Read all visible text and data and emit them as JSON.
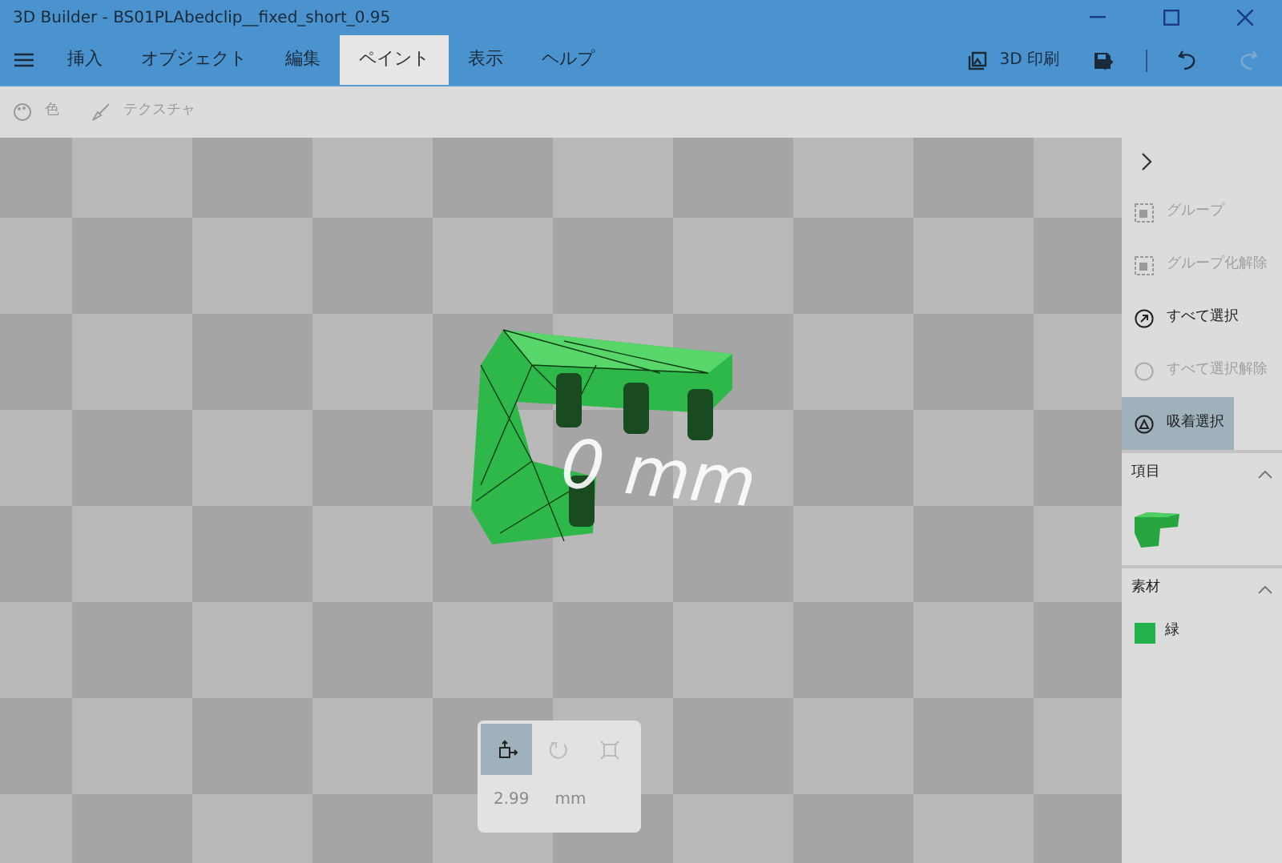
{
  "window": {
    "title": "3D Builder - BS01PLAbedclip__fixed_short_0.95"
  },
  "menu_tabs": [
    {
      "label": "挿入",
      "selected": false
    },
    {
      "label": "オブジェクト",
      "selected": false
    },
    {
      "label": "編集",
      "selected": false
    },
    {
      "label": "ペイント",
      "selected": true
    },
    {
      "label": "表示",
      "selected": false
    },
    {
      "label": "ヘルプ",
      "selected": false
    }
  ],
  "print_button": {
    "label": "3D 印刷"
  },
  "toolbar": [
    {
      "kind": "palette",
      "label": "色"
    },
    {
      "kind": "brush",
      "label": "テクスチャ"
    }
  ],
  "viewport": {
    "dimension_label": "0 mm"
  },
  "side_actions": [
    {
      "kind": "group",
      "label": "グループ",
      "disabled": true,
      "selected": false
    },
    {
      "kind": "ungroup",
      "label": "グループ化解除",
      "disabled": true,
      "selected": false
    },
    {
      "kind": "select_all",
      "label": "すべて選択",
      "disabled": false,
      "selected": false
    },
    {
      "kind": "deselect",
      "label": "すべて選択解除",
      "disabled": true,
      "selected": false
    },
    {
      "kind": "snap",
      "label": "吸着選択",
      "disabled": false,
      "selected": true
    }
  ],
  "sections": [
    {
      "kind": "items",
      "title": "項目",
      "expanded": true
    },
    {
      "kind": "materials",
      "title": "素材",
      "expanded": true,
      "materials": [
        {
          "label": "緑",
          "color": "#22b14c"
        }
      ]
    }
  ],
  "transform_tools": [
    {
      "kind": "move",
      "selected": true
    },
    {
      "kind": "rotate",
      "selected": false
    },
    {
      "kind": "scale",
      "selected": false
    }
  ],
  "transform_value": {
    "value": "2.99",
    "unit": "mm"
  }
}
